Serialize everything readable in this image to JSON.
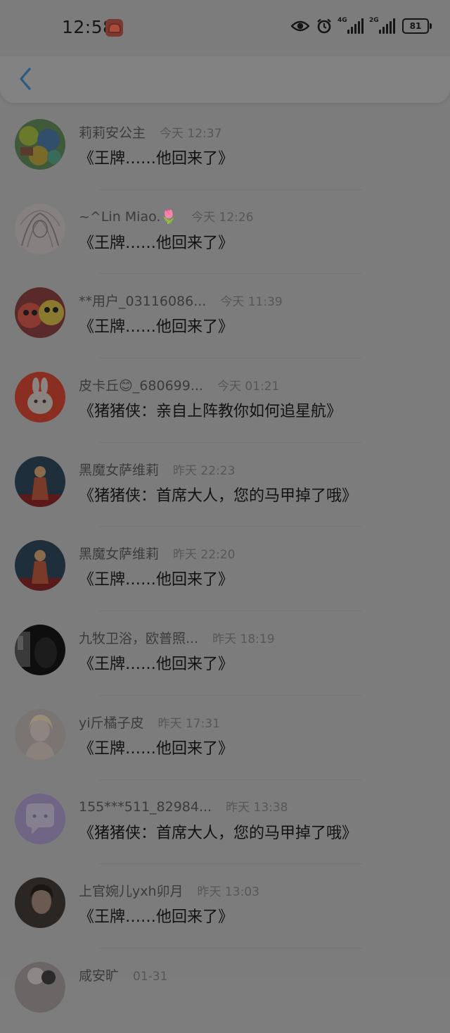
{
  "status_bar": {
    "time": "12:58",
    "signal_1_label": "4G",
    "signal_2_label": "2G",
    "battery": "81"
  },
  "header": {
    "back_icon": "chevron-left-icon",
    "accent_color": "#2a5a80"
  },
  "comments": [
    {
      "user": "莉莉安公主",
      "time": "今天 12:37",
      "title": "《王牌……他回来了》"
    },
    {
      "user": "~^Lin Miao.🌷",
      "time": "今天 12:26",
      "title": "《王牌……他回来了》"
    },
    {
      "user": "**用户_03116086...",
      "time": "今天 11:39",
      "title": "《王牌……他回来了》"
    },
    {
      "user": "皮卡丘😊_680699...",
      "time": "今天 01:21",
      "title": "《猪猪侠：亲自上阵教你如何追星航》"
    },
    {
      "user": "黑魔女萨维莉",
      "time": "昨天 22:23",
      "title": "《猪猪侠：首席大人，您的马甲掉了哦》"
    },
    {
      "user": "黑魔女萨维莉",
      "time": "昨天 22:20",
      "title": "《王牌……他回来了》"
    },
    {
      "user": "九牧卫浴，欧普照...",
      "time": "昨天 18:19",
      "title": "《王牌……他回来了》"
    },
    {
      "user": "yi斤橘子皮",
      "time": "昨天 17:31",
      "title": "《王牌……他回来了》"
    },
    {
      "user": "155***511_82984...",
      "time": "昨天 13:38",
      "title": "《猪猪侠：首席大人，您的马甲掉了哦》"
    },
    {
      "user": "上官婉儿yxh卯月",
      "time": "昨天 13:03",
      "title": "《王牌……他回来了》"
    },
    {
      "user": "咸安旷",
      "time": "01-31",
      "title": ""
    }
  ]
}
